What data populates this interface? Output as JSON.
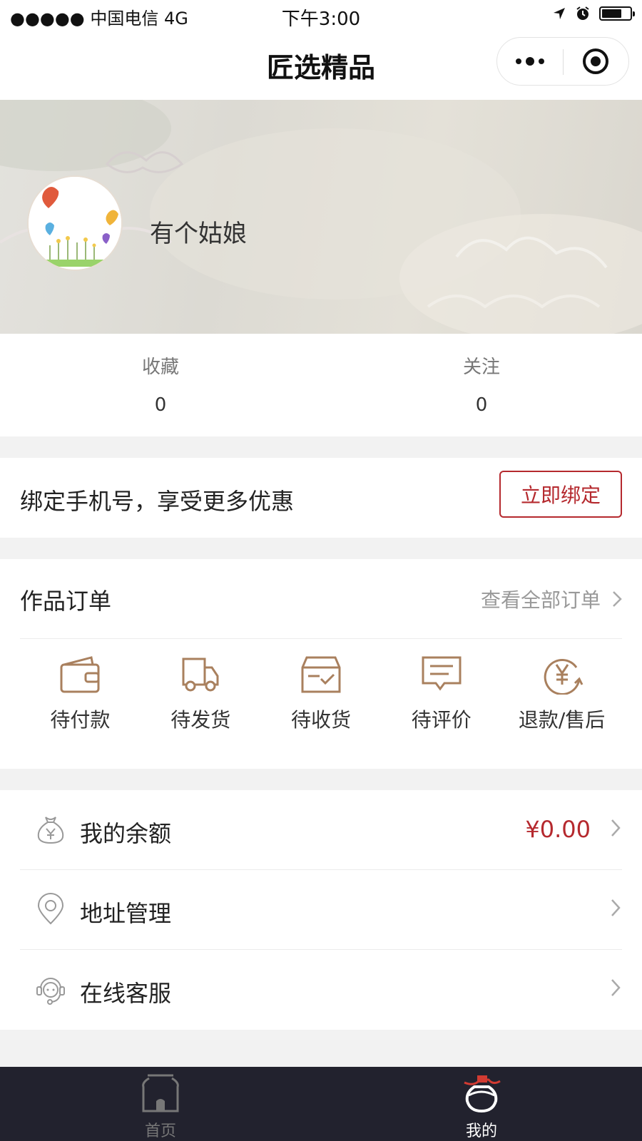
{
  "status_bar": {
    "carrier": "●●●●● 中国电信   4G",
    "time": "下午3:00",
    "battery_level": 0.7
  },
  "navbar": {
    "title": "匠选精品",
    "more_icon": "more-dots-icon",
    "close_icon": "target-close-icon"
  },
  "profile": {
    "username": "有个姑娘",
    "avatar_icon": "avatar-illustration"
  },
  "stats": [
    {
      "label": "收藏",
      "value": "0"
    },
    {
      "label": "关注",
      "value": "0"
    }
  ],
  "bind": {
    "text": "绑定手机号，享受更多优惠",
    "button": "立即绑定"
  },
  "orders": {
    "title": "作品订单",
    "view_all": "查看全部订单",
    "items": [
      {
        "label": "待付款",
        "icon": "wallet-icon"
      },
      {
        "label": "待发货",
        "icon": "truck-icon"
      },
      {
        "label": "待收货",
        "icon": "box-check-icon"
      },
      {
        "label": "待评价",
        "icon": "comment-icon"
      },
      {
        "label": "退款/售后",
        "icon": "refund-icon"
      }
    ]
  },
  "menu": [
    {
      "label": "我的余额",
      "value": "¥0.00",
      "icon": "money-bag-icon"
    },
    {
      "label": "地址管理",
      "value": "",
      "icon": "location-pin-icon"
    },
    {
      "label": "在线客服",
      "value": "",
      "icon": "customer-service-icon"
    }
  ],
  "tabbar": {
    "tabs": [
      {
        "label": "首页",
        "icon": "home-icon",
        "active": false
      },
      {
        "label": "我的",
        "icon": "profile-pot-icon",
        "active": true
      }
    ]
  },
  "colors": {
    "accent": "#b5292e",
    "icon_brown": "#a9805e",
    "tabbar_bg": "#22222e"
  }
}
